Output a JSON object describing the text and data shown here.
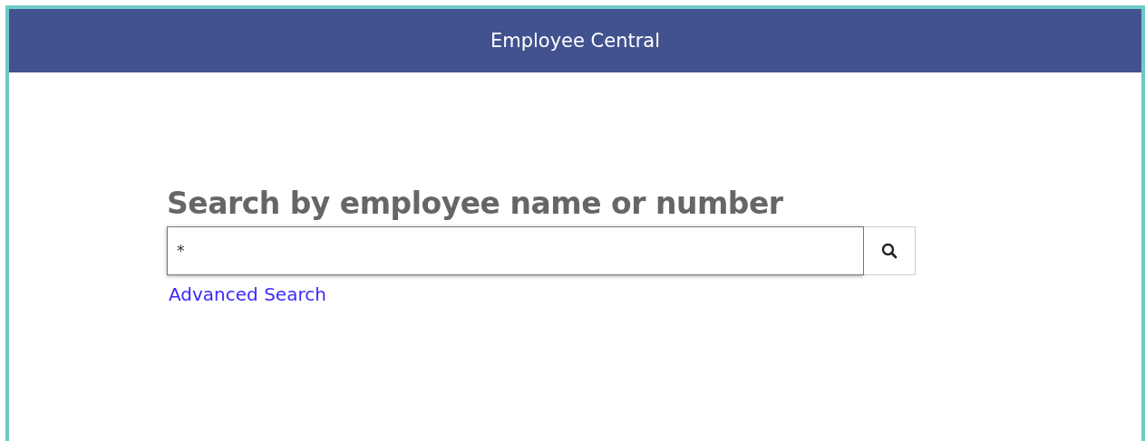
{
  "header": {
    "title": "Employee Central"
  },
  "search": {
    "heading": "Search by employee name or number",
    "value": "*",
    "advanced_link": "Advanced Search"
  }
}
